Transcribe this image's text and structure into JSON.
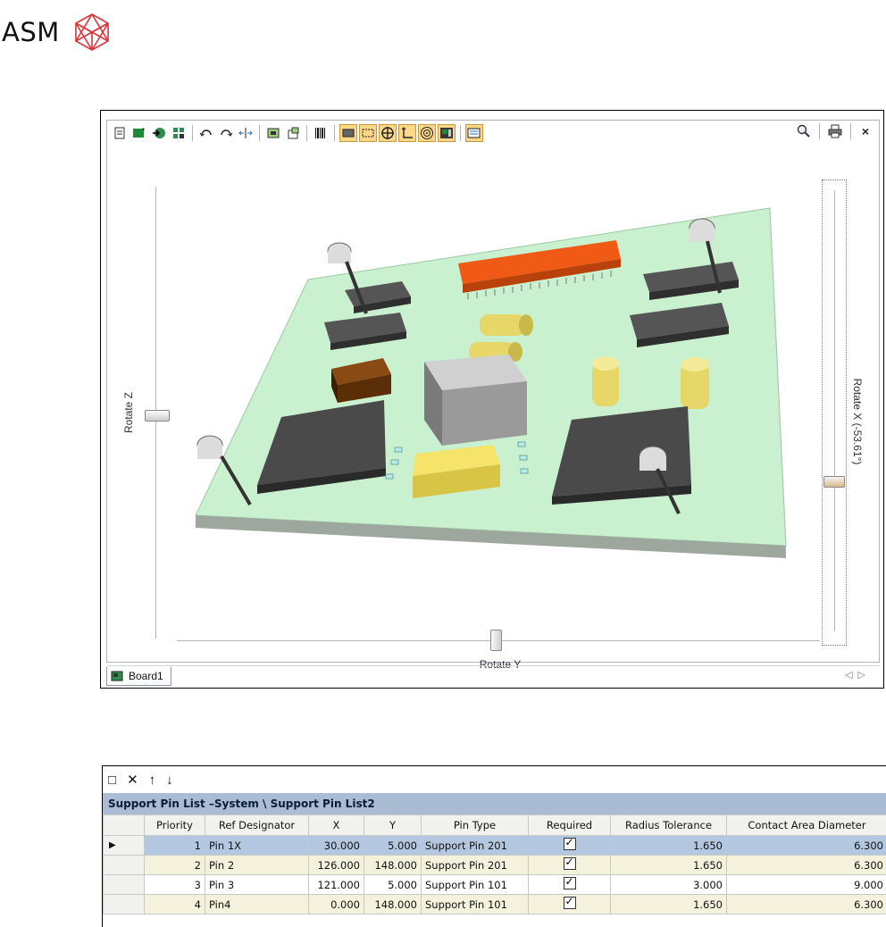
{
  "logo": {
    "text": "ASM"
  },
  "viewer": {
    "toolbar_icons": [
      "new-doc-icon",
      "add-image-icon",
      "import-icon",
      "grid-icon",
      "rotate-left-icon",
      "rotate-right-icon",
      "flip-icon",
      "board-icon",
      "component-icon",
      "barcode-icon",
      "rect-view-icon",
      "outline-icon",
      "crosshair-icon",
      "axis-icon",
      "target-icon",
      "chip-icon",
      "layers-icon"
    ],
    "active_icons": [
      "rect-view-icon",
      "outline-icon",
      "crosshair-icon",
      "axis-icon",
      "target-icon",
      "chip-icon",
      "layers-icon"
    ],
    "rotate_z_label": "Rotate Z",
    "rotate_x_label": "Rotate X (-53.61°)",
    "rotate_y_label": "Rotate Y",
    "rotate_x_value": -53.61,
    "sheet_tab": "Board1",
    "colors": {
      "board": "#c9f0cf",
      "chip": "#505050",
      "orange_chip": "#f05a14",
      "yellow": "#f5e36a"
    }
  },
  "pinlist": {
    "toolbar": [
      "new-icon",
      "delete-icon",
      "up-arrow-icon",
      "down-arrow-icon"
    ],
    "title": "Support Pin List –System \\ Support Pin List2",
    "columns": [
      "",
      "Priority",
      "Ref Designator",
      "X",
      "Y",
      "Pin Type",
      "Required",
      "Radius Tolerance",
      "Contact Area Diameter"
    ],
    "rows": [
      {
        "marker": "▶",
        "priority": "1",
        "ref": "Pin 1X",
        "x": "30.000",
        "y": "5.000",
        "type": "Support Pin 201",
        "required": true,
        "radius": "1.650",
        "contact": "6.300"
      },
      {
        "marker": "",
        "priority": "2",
        "ref": "Pin 2",
        "x": "126.000",
        "y": "148.000",
        "type": "Support Pin 201",
        "required": true,
        "radius": "1.650",
        "contact": "6.300"
      },
      {
        "marker": "",
        "priority": "3",
        "ref": "Pin 3",
        "x": "121.000",
        "y": "5.000",
        "type": "Support Pin 101",
        "required": true,
        "radius": "3.000",
        "contact": "9.000"
      },
      {
        "marker": "",
        "priority": "4",
        "ref": "Pin4",
        "x": "0.000",
        "y": "148.000",
        "type": "Support Pin 101",
        "required": true,
        "radius": "1.650",
        "contact": "6.300"
      }
    ]
  }
}
